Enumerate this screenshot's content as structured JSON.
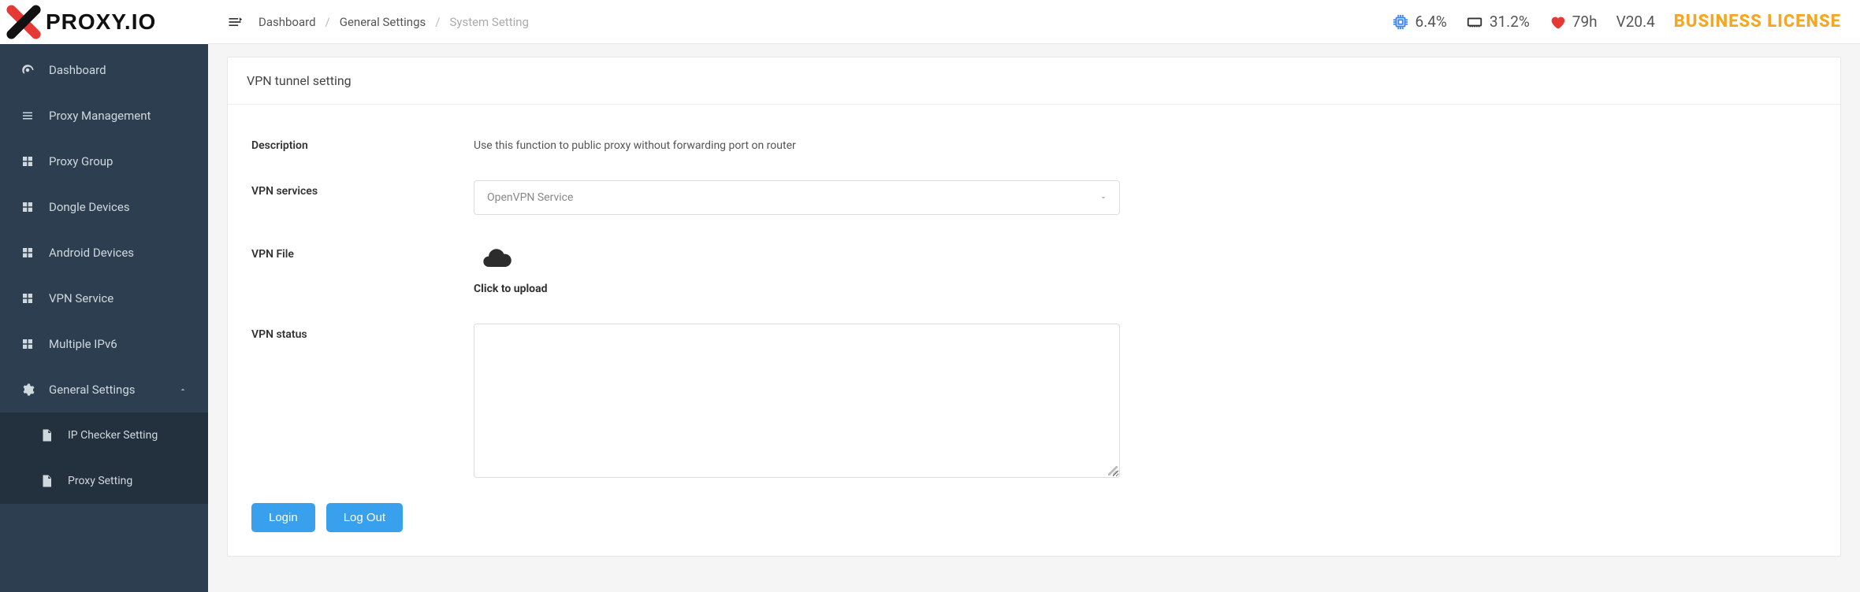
{
  "logo": {
    "text": "PROXY.IO"
  },
  "sidebar": {
    "items": [
      {
        "label": "Dashboard"
      },
      {
        "label": "Proxy Management"
      },
      {
        "label": "Proxy Group"
      },
      {
        "label": "Dongle Devices"
      },
      {
        "label": "Android Devices"
      },
      {
        "label": "VPN Service"
      },
      {
        "label": "Multiple IPv6"
      },
      {
        "label": "General Settings"
      }
    ],
    "submenu": [
      {
        "label": "IP Checker Setting"
      },
      {
        "label": "Proxy Setting"
      }
    ]
  },
  "breadcrumbs": {
    "a": "Dashboard",
    "b": "General Settings",
    "c": "System Setting"
  },
  "topbar": {
    "cpu": "6.4%",
    "ram": "31.2%",
    "uptime": "79h",
    "version": "V20.4",
    "license": "BUSINESS LICENSE"
  },
  "card": {
    "title": "VPN tunnel setting",
    "fields": {
      "description_label": "Description",
      "description_value": "Use this function to public proxy without forwarding port on router",
      "vpn_services_label": "VPN services",
      "vpn_services_selected": "OpenVPN Service",
      "vpn_file_label": "VPN File",
      "upload_text": "Click to upload",
      "vpn_status_label": "VPN status",
      "vpn_status_value": ""
    },
    "actions": {
      "login": "Login",
      "logout": "Log Out"
    }
  }
}
